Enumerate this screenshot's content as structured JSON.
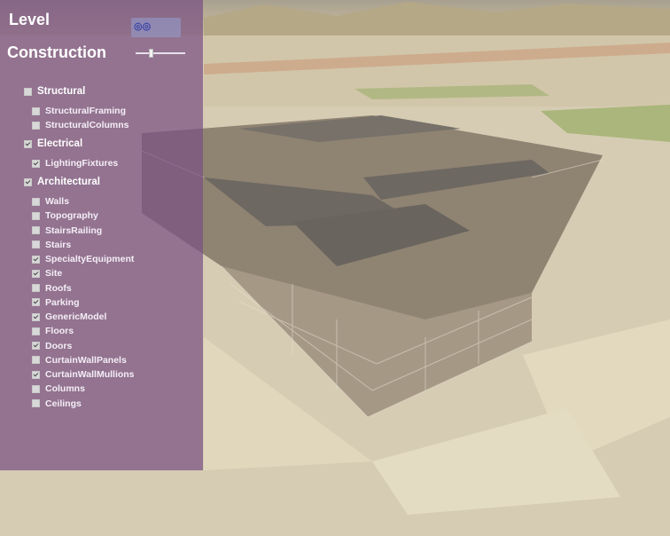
{
  "header": {
    "level_label": "Level",
    "construction_label": "Construction"
  },
  "icons": {
    "level_selector": "viewer-icon"
  },
  "colors": {
    "panel": "#78508280",
    "checkbox_checked": "#d8d8d8"
  },
  "categories": [
    {
      "label": "Structural",
      "checked": false,
      "items": [
        {
          "label": "StructuralFraming",
          "checked": false
        },
        {
          "label": "StructuralColumns",
          "checked": false
        }
      ]
    },
    {
      "label": "Electrical",
      "checked": true,
      "items": [
        {
          "label": "LightingFixtures",
          "checked": true
        }
      ]
    },
    {
      "label": "Architectural",
      "checked": true,
      "items": [
        {
          "label": "Walls",
          "checked": false
        },
        {
          "label": "Topography",
          "checked": false
        },
        {
          "label": "StairsRailing",
          "checked": false
        },
        {
          "label": "Stairs",
          "checked": false
        },
        {
          "label": "SpecialtyEquipment",
          "checked": true
        },
        {
          "label": "Site",
          "checked": true
        },
        {
          "label": "Roofs",
          "checked": false
        },
        {
          "label": "Parking",
          "checked": true
        },
        {
          "label": "GenericModel",
          "checked": true
        },
        {
          "label": "Floors",
          "checked": false
        },
        {
          "label": "Doors",
          "checked": true
        },
        {
          "label": "CurtainWallPanels",
          "checked": false
        },
        {
          "label": "CurtainWallMullions",
          "checked": true
        },
        {
          "label": "Columns",
          "checked": false
        },
        {
          "label": "Ceilings",
          "checked": false
        }
      ]
    }
  ],
  "slider": {
    "value": 0.3
  }
}
